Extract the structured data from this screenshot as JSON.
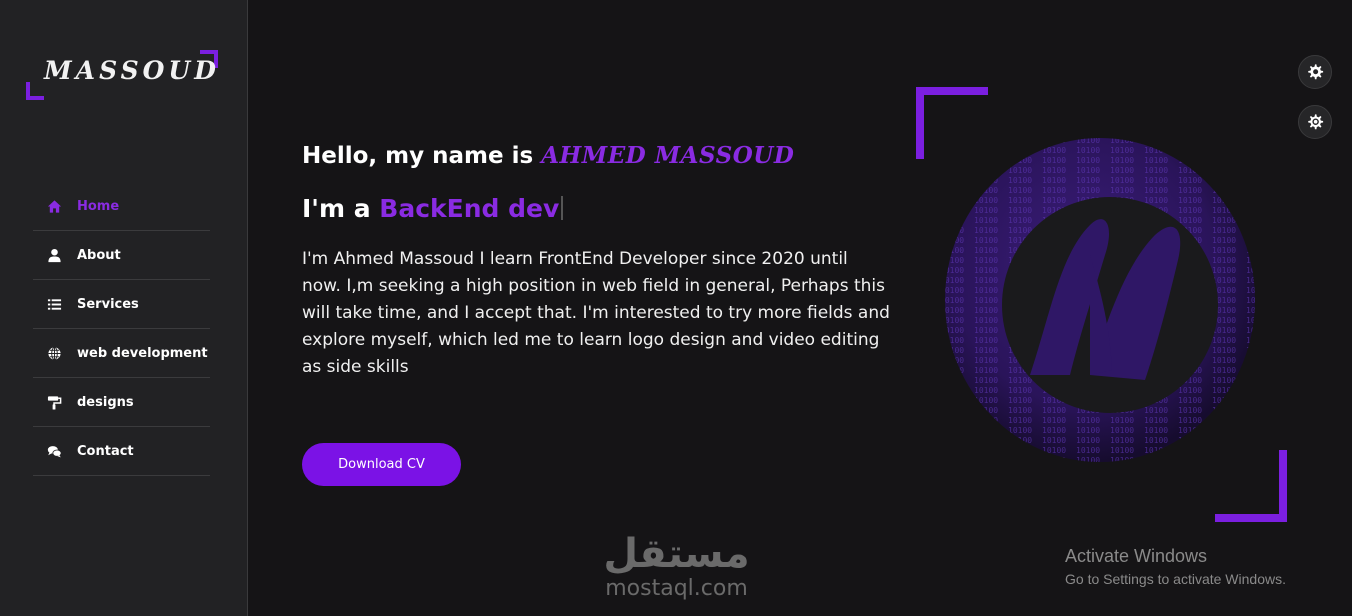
{
  "colors": {
    "accent": "#7b1fe0",
    "background": "#151416",
    "sidebar": "#222224"
  },
  "sidebar": {
    "logo": "MASSOUD",
    "items": [
      {
        "label": "Home",
        "icon": "home-icon",
        "active": true
      },
      {
        "label": "About",
        "icon": "user-icon",
        "active": false
      },
      {
        "label": "Services",
        "icon": "list-icon",
        "active": false
      },
      {
        "label": "web development",
        "icon": "globe-icon",
        "active": false
      },
      {
        "label": "designs",
        "icon": "paint-roller-icon",
        "active": false
      },
      {
        "label": "Contact",
        "icon": "chat-icon",
        "active": false
      }
    ]
  },
  "hero": {
    "greeting": "Hello, my name is ",
    "name": "AHMED MASSOUD",
    "role_prefix": "I'm a ",
    "role": "BackEnd dev",
    "bio": "I'm Ahmed Massoud I learn FrontEnd Developer since 2020 until now. I,m seeking a high position in web field in general, Perhaps this will take time, and I accept that. I'm interested to try more fields and explore myself, which led me to learn logo design and video editing as side skills",
    "cv_button": "Download CV",
    "image_icon": "binary-globe-logo-icon"
  },
  "settings": {
    "icons": [
      "gear-icon",
      "gear-icon"
    ]
  },
  "watermark": {
    "arabic": "مستقل",
    "latin": "mostaql.com"
  },
  "windows_notice": {
    "title": "Activate Windows",
    "subtitle": "Go to Settings to activate Windows."
  }
}
